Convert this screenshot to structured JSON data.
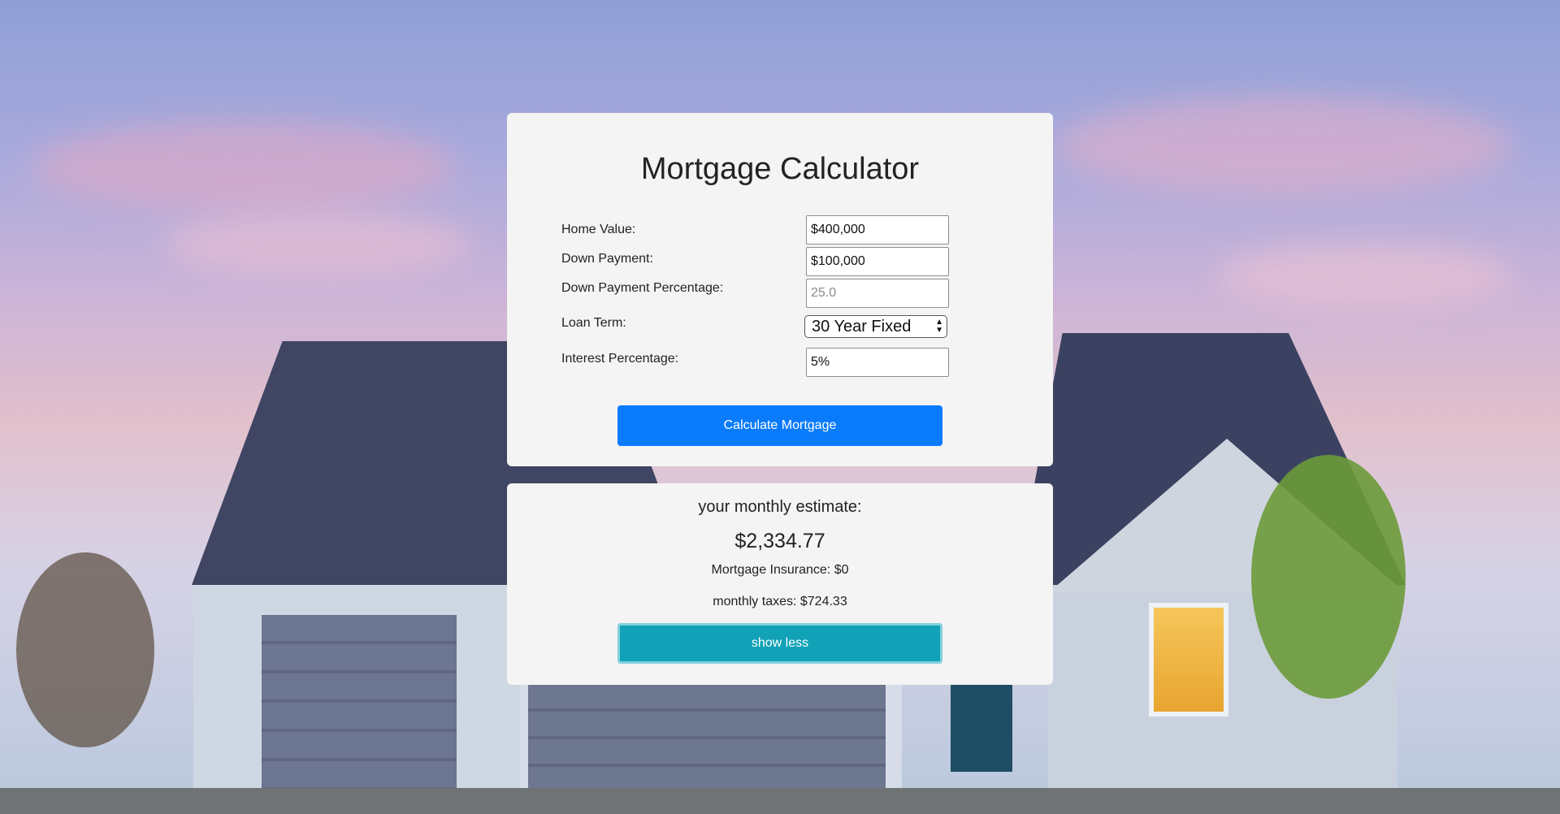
{
  "form": {
    "title": "Mortgage Calculator",
    "home_value": {
      "label": "Home Value:",
      "value": "$400,000"
    },
    "down_payment": {
      "label": "Down Payment:",
      "value": "$100,000"
    },
    "down_payment_percentage": {
      "label": "Down Payment Percentage:",
      "placeholder": "25.0"
    },
    "loan_term": {
      "label": "Loan Term:",
      "selected": "30 Year Fixed"
    },
    "interest": {
      "label": "Interest Percentage:",
      "value": "5%"
    },
    "calculate_label": "Calculate Mortgage"
  },
  "result": {
    "heading": "your monthly estimate:",
    "amount": "$2,334.77",
    "insurance": "Mortgage Insurance: $0",
    "taxes": "monthly taxes: $724.33",
    "toggle_label": "show less"
  },
  "colors": {
    "primary_button": "#0a7bfb",
    "info_button": "#11a2b8",
    "card": "#f4f4f4"
  }
}
